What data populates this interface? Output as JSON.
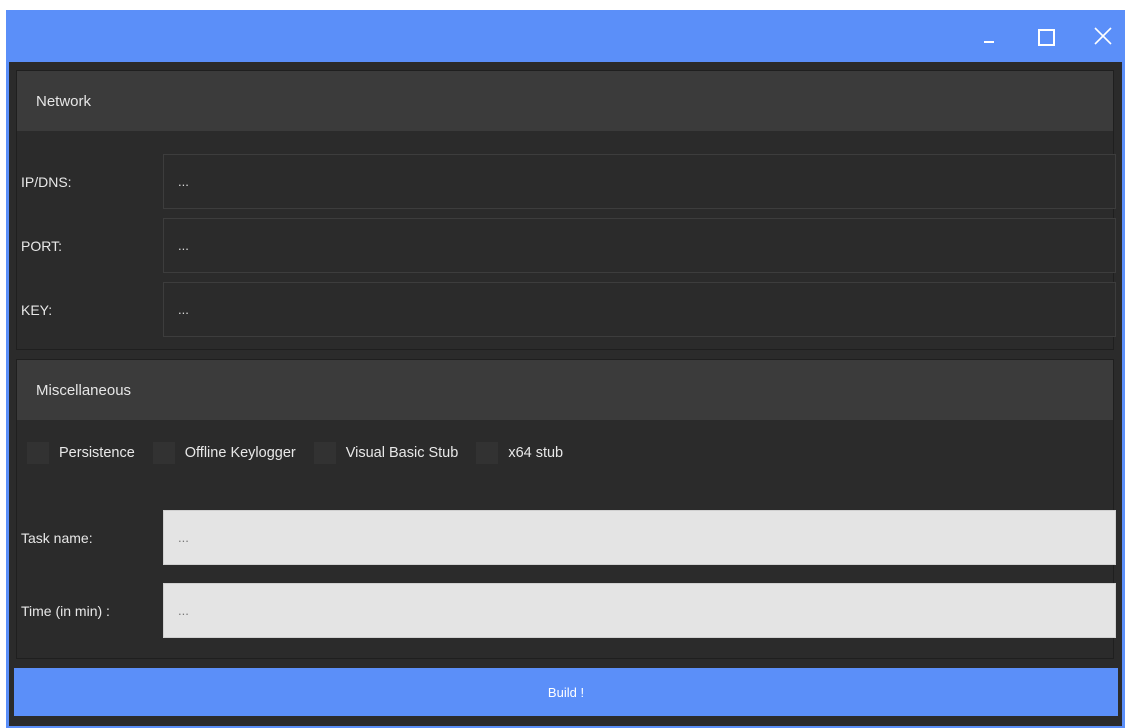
{
  "titlebar": {
    "controls": [
      {
        "name": "minimize",
        "icon": "minimize-icon"
      },
      {
        "name": "maximize",
        "icon": "maximize-icon"
      },
      {
        "name": "close",
        "icon": "close-icon"
      }
    ]
  },
  "network": {
    "header": "Network",
    "fields": [
      {
        "label": "IP/DNS:",
        "value": "..."
      },
      {
        "label": "PORT:",
        "value": "..."
      },
      {
        "label": "KEY:",
        "value": "..."
      }
    ]
  },
  "misc": {
    "header": "Miscellaneous",
    "checkboxes": [
      {
        "label": "Persistence",
        "checked": false
      },
      {
        "label": "Offline Keylogger",
        "checked": false
      },
      {
        "label": "Visual Basic Stub",
        "checked": false
      },
      {
        "label": "x64 stub",
        "checked": false
      }
    ],
    "fields": [
      {
        "label": "Task name:",
        "value": "..."
      },
      {
        "label": "Time (in min) :",
        "value": "..."
      }
    ]
  },
  "build": {
    "label": "Build !"
  },
  "colors": {
    "accent": "#5b8ff9",
    "background": "#2b2b2b",
    "header": "#3b3b3b"
  }
}
